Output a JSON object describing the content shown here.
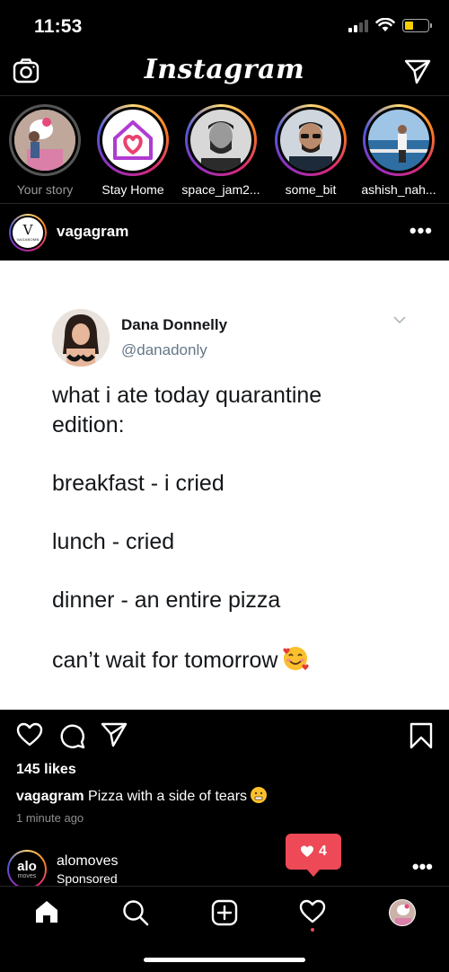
{
  "status_bar": {
    "time": "11:53"
  },
  "header": {
    "app_title": "Instagram"
  },
  "stories": [
    {
      "label": "Your story",
      "own": true
    },
    {
      "label": "Stay Home"
    },
    {
      "label": "space_jam2..."
    },
    {
      "label": "some_bit"
    },
    {
      "label": "ashish_nah..."
    }
  ],
  "post": {
    "username": "vagagram",
    "avatar_letter": "V",
    "avatar_subtext": "VAGABOMB",
    "tweet": {
      "name": "Dana Donnelly",
      "handle": "@danadonly",
      "lines": [
        "what i ate today quarantine edition:",
        "breakfast - i cried",
        "lunch - cried",
        "dinner - an entire pizza",
        "can’t wait for tomorrow"
      ]
    },
    "likes": "145 likes",
    "caption_user": "vagagram",
    "caption_text": "Pizza with a side of tears",
    "time_ago": "1 minute ago"
  },
  "sponsored": {
    "account": "alomoves",
    "label": "Sponsored",
    "logo_top": "alo",
    "logo_bottom": "moves"
  },
  "notification": {
    "count": "4"
  },
  "icons": {
    "camera": "camera-icon",
    "direct": "paper-plane-icon",
    "more": "more-dots-icon",
    "like": "heart-icon",
    "comment": "comment-icon",
    "share": "share-icon",
    "save": "bookmark-icon",
    "home": "home-icon",
    "search": "search-icon",
    "new_post": "add-post-icon",
    "activity": "heart-icon"
  },
  "colors": {
    "notification": "#ed4956",
    "background": "#000000"
  }
}
